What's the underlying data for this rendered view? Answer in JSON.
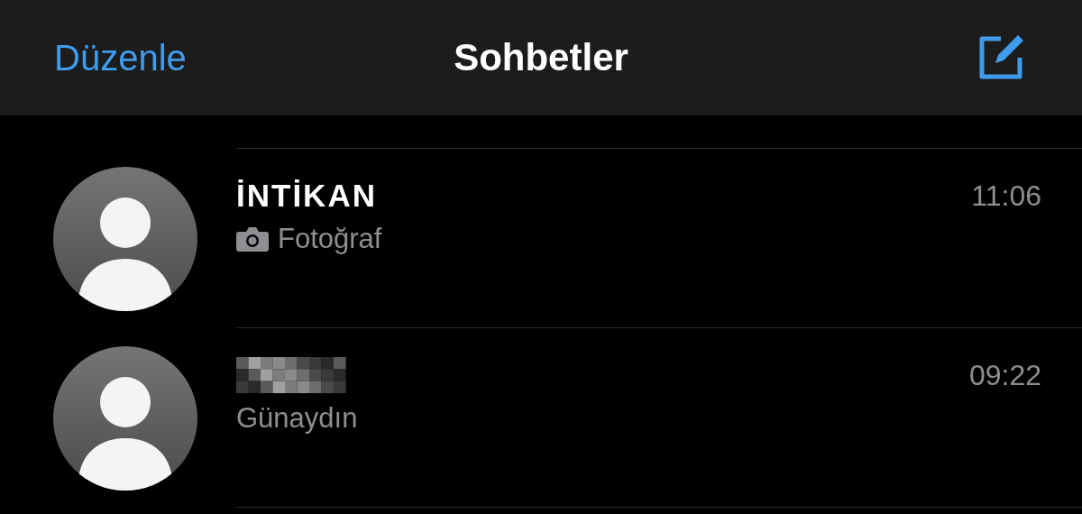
{
  "header": {
    "edit_button": "Düzenle",
    "title": "Sohbetler"
  },
  "chats": [
    {
      "name": "İNTİKAN",
      "name_redacted": false,
      "time": "11:06",
      "preview": "Fotoğraf",
      "kind": "photo"
    },
    {
      "name_redacted": true,
      "time": "09:22",
      "preview": "Günaydın",
      "kind": "text"
    }
  ]
}
